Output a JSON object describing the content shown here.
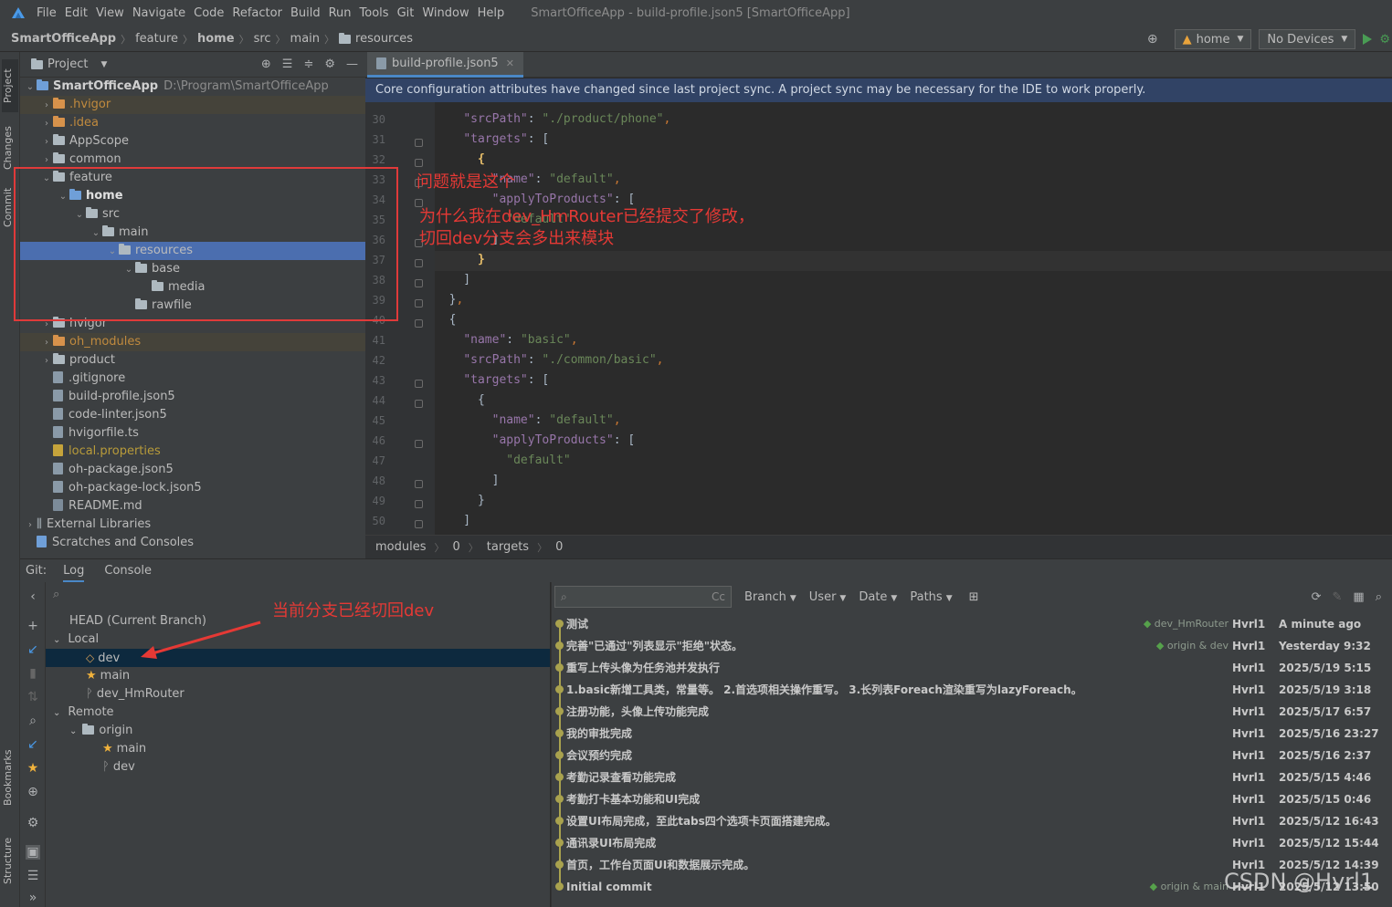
{
  "menu": {
    "items": [
      "File",
      "Edit",
      "View",
      "Navigate",
      "Code",
      "Refactor",
      "Build",
      "Run",
      "Tools",
      "Git",
      "Window",
      "Help"
    ],
    "title": "SmartOfficeApp - build-profile.json5 [SmartOfficeApp]"
  },
  "nav": {
    "crumbs": [
      "SmartOfficeApp",
      "feature",
      "home",
      "src",
      "main",
      "resources"
    ],
    "branch_combo": "home",
    "device_combo": "No Devices"
  },
  "left_stripe": {
    "project": "Project",
    "changes": "Changes",
    "commit": "Commit",
    "bookmarks": "Bookmarks",
    "structure": "Structure"
  },
  "project_panel": {
    "title": "Project",
    "root": "SmartOfficeApp",
    "root_path": "D:\\Program\\SmartOfficeApp",
    "items": [
      {
        "label": ".hvigor",
        "type": "folder-orange",
        "depth": 1,
        "arrow": "›",
        "style": "excluded"
      },
      {
        "label": ".idea",
        "type": "folder-orange",
        "depth": 1,
        "arrow": "›",
        "style": "orange"
      },
      {
        "label": "AppScope",
        "type": "folder",
        "depth": 1,
        "arrow": "›"
      },
      {
        "label": "common",
        "type": "folder",
        "depth": 1,
        "arrow": "›"
      },
      {
        "label": "feature",
        "type": "folder",
        "depth": 1,
        "arrow": "⌄"
      },
      {
        "label": "home",
        "type": "folder-blue",
        "depth": 2,
        "arrow": "⌄",
        "bold": true
      },
      {
        "label": "src",
        "type": "folder",
        "depth": 3,
        "arrow": "⌄"
      },
      {
        "label": "main",
        "type": "folder",
        "depth": 4,
        "arrow": "⌄"
      },
      {
        "label": "resources",
        "type": "folder",
        "depth": 5,
        "arrow": "⌄",
        "style": "selected"
      },
      {
        "label": "base",
        "type": "folder",
        "depth": 6,
        "arrow": "⌄"
      },
      {
        "label": "media",
        "type": "folder",
        "depth": 7,
        "arrow": ""
      },
      {
        "label": "rawfile",
        "type": "folder",
        "depth": 6,
        "arrow": ""
      },
      {
        "label": "hvigor",
        "type": "folder",
        "depth": 1,
        "arrow": "›"
      },
      {
        "label": "oh_modules",
        "type": "folder-orange",
        "depth": 1,
        "arrow": "›",
        "style": "excluded-orange"
      },
      {
        "label": "product",
        "type": "folder",
        "depth": 1,
        "arrow": "›"
      },
      {
        "label": ".gitignore",
        "type": "file",
        "depth": 1,
        "arrow": ""
      },
      {
        "label": "build-profile.json5",
        "type": "file",
        "depth": 1,
        "arrow": ""
      },
      {
        "label": "code-linter.json5",
        "type": "file",
        "depth": 1,
        "arrow": ""
      },
      {
        "label": "hvigorfile.ts",
        "type": "file",
        "depth": 1,
        "arrow": ""
      },
      {
        "label": "local.properties",
        "type": "file-gold",
        "depth": 1,
        "arrow": "",
        "style": "gold"
      },
      {
        "label": "oh-package.json5",
        "type": "file",
        "depth": 1,
        "arrow": ""
      },
      {
        "label": "oh-package-lock.json5",
        "type": "file",
        "depth": 1,
        "arrow": ""
      },
      {
        "label": "README.md",
        "type": "file-md",
        "depth": 1,
        "arrow": ""
      },
      {
        "label": "External Libraries",
        "type": "lib",
        "depth": 0,
        "arrow": "›"
      },
      {
        "label": "Scratches and Consoles",
        "type": "scratch",
        "depth": 0,
        "arrow": ""
      }
    ]
  },
  "editor": {
    "tab": "build-profile.json5",
    "banner": "Core configuration attributes have changed since last project sync. A project sync may be necessary for the IDE to work properly.",
    "lines": [
      {
        "n": "30",
        "html": "    <span class='k'>\"srcPath\"</span>: <span class='s'>\"./product/phone\"</span><span class='p'>,</span>"
      },
      {
        "n": "31",
        "html": "    <span class='k'>\"targets\"</span>: ["
      },
      {
        "n": "32",
        "html": "      <span class='br'>{</span>"
      },
      {
        "n": "33",
        "html": "        <span class='k'>\"name\"</span>: <span class='s'>\"default\"</span><span class='p'>,</span>"
      },
      {
        "n": "34",
        "html": "        <span class='k'>\"applyToProducts\"</span>: ["
      },
      {
        "n": "35",
        "html": "          <span class='s'>\"default\"</span>"
      },
      {
        "n": "36",
        "html": "        ]"
      },
      {
        "n": "37",
        "html": "      <span class='br'>}</span>"
      },
      {
        "n": "38",
        "html": "    ]"
      },
      {
        "n": "39",
        "html": "  }<span class='p'>,</span>"
      },
      {
        "n": "40",
        "html": "  {"
      },
      {
        "n": "41",
        "html": "    <span class='k'>\"name\"</span>: <span class='s'>\"basic\"</span><span class='p'>,</span>"
      },
      {
        "n": "42",
        "html": "    <span class='k'>\"srcPath\"</span>: <span class='s'>\"./common/basic\"</span><span class='p'>,</span>"
      },
      {
        "n": "43",
        "html": "    <span class='k'>\"targets\"</span>: ["
      },
      {
        "n": "44",
        "html": "      {"
      },
      {
        "n": "45",
        "html": "        <span class='k'>\"name\"</span>: <span class='s'>\"default\"</span><span class='p'>,</span>"
      },
      {
        "n": "46",
        "html": "        <span class='k'>\"applyToProducts\"</span>: ["
      },
      {
        "n": "47",
        "html": "          <span class='s'>\"default\"</span>"
      },
      {
        "n": "48",
        "html": "        ]"
      },
      {
        "n": "49",
        "html": "      }"
      },
      {
        "n": "50",
        "html": "    ]"
      }
    ],
    "breadcrumb": [
      "modules",
      "0",
      "targets",
      "0"
    ]
  },
  "git": {
    "label": "Git:",
    "tabs": [
      "Log",
      "Console"
    ],
    "branches": {
      "head": "HEAD (Current Branch)",
      "local": "Local",
      "local_items": [
        {
          "label": "dev",
          "icon": "tag",
          "selected": true
        },
        {
          "label": "main",
          "icon": "star"
        },
        {
          "label": "dev_HmRouter",
          "icon": "branch"
        }
      ],
      "remote": "Remote",
      "origin": "origin",
      "remote_items": [
        {
          "label": "main",
          "icon": "star"
        },
        {
          "label": "dev",
          "icon": "branch"
        }
      ]
    },
    "filters": [
      "Branch",
      "User",
      "Date",
      "Paths"
    ],
    "search_hint": "Cc",
    "commits": [
      {
        "msg": "测试",
        "refs": "dev_HmRouter",
        "author": "Hvrl1",
        "date": "A minute ago"
      },
      {
        "msg": "完善\"已通过\"列表显示\"拒绝\"状态。",
        "refs": "origin & dev",
        "author": "Hvrl1",
        "date": "Yesterday 9:32"
      },
      {
        "msg": "重写上传头像为任务池并发执行",
        "refs": "",
        "author": "Hvrl1",
        "date": "2025/5/19 5:15"
      },
      {
        "msg": "1.basic新增工具类，常量等。 2.首选项相关操作重写。 3.长列表Foreach渲染重写为lazyForeach。",
        "refs": "",
        "author": "Hvrl1",
        "date": "2025/5/19 3:18"
      },
      {
        "msg": "注册功能，头像上传功能完成",
        "refs": "",
        "author": "Hvrl1",
        "date": "2025/5/17 6:57"
      },
      {
        "msg": "我的审批完成",
        "refs": "",
        "author": "Hvrl1",
        "date": "2025/5/16 23:27"
      },
      {
        "msg": "会议预约完成",
        "refs": "",
        "author": "Hvrl1",
        "date": "2025/5/16 2:37"
      },
      {
        "msg": "考勤记录查看功能完成",
        "refs": "",
        "author": "Hvrl1",
        "date": "2025/5/15 4:46"
      },
      {
        "msg": "考勤打卡基本功能和UI完成",
        "refs": "",
        "author": "Hvrl1",
        "date": "2025/5/15 0:46"
      },
      {
        "msg": "设置UI布局完成，至此tabs四个选项卡页面搭建完成。",
        "refs": "",
        "author": "Hvrl1",
        "date": "2025/5/12 16:43"
      },
      {
        "msg": "通讯录UI布局完成",
        "refs": "",
        "author": "Hvrl1",
        "date": "2025/5/12 15:44"
      },
      {
        "msg": "首页，工作台页面UI和数据展示完成。",
        "refs": "",
        "author": "Hvrl1",
        "date": "2025/5/12 14:39"
      },
      {
        "msg": "Initial commit",
        "refs": "origin & main",
        "author": "Hvrl1",
        "date": "2025/5/12 13:50"
      }
    ]
  },
  "annotations": {
    "note1": "问题就是这个",
    "note2": "为什么我在dev_HmRouter已经提交了修改，",
    "note3": "切回dev分支会多出来模块",
    "note4": "当前分支已经切回dev"
  },
  "watermark": "CSDN @Hvrl1",
  "colors": {
    "selection": "#4b6eaf",
    "annotation": "#e53935",
    "graph": "#a9a24e",
    "banner": "#314365"
  }
}
